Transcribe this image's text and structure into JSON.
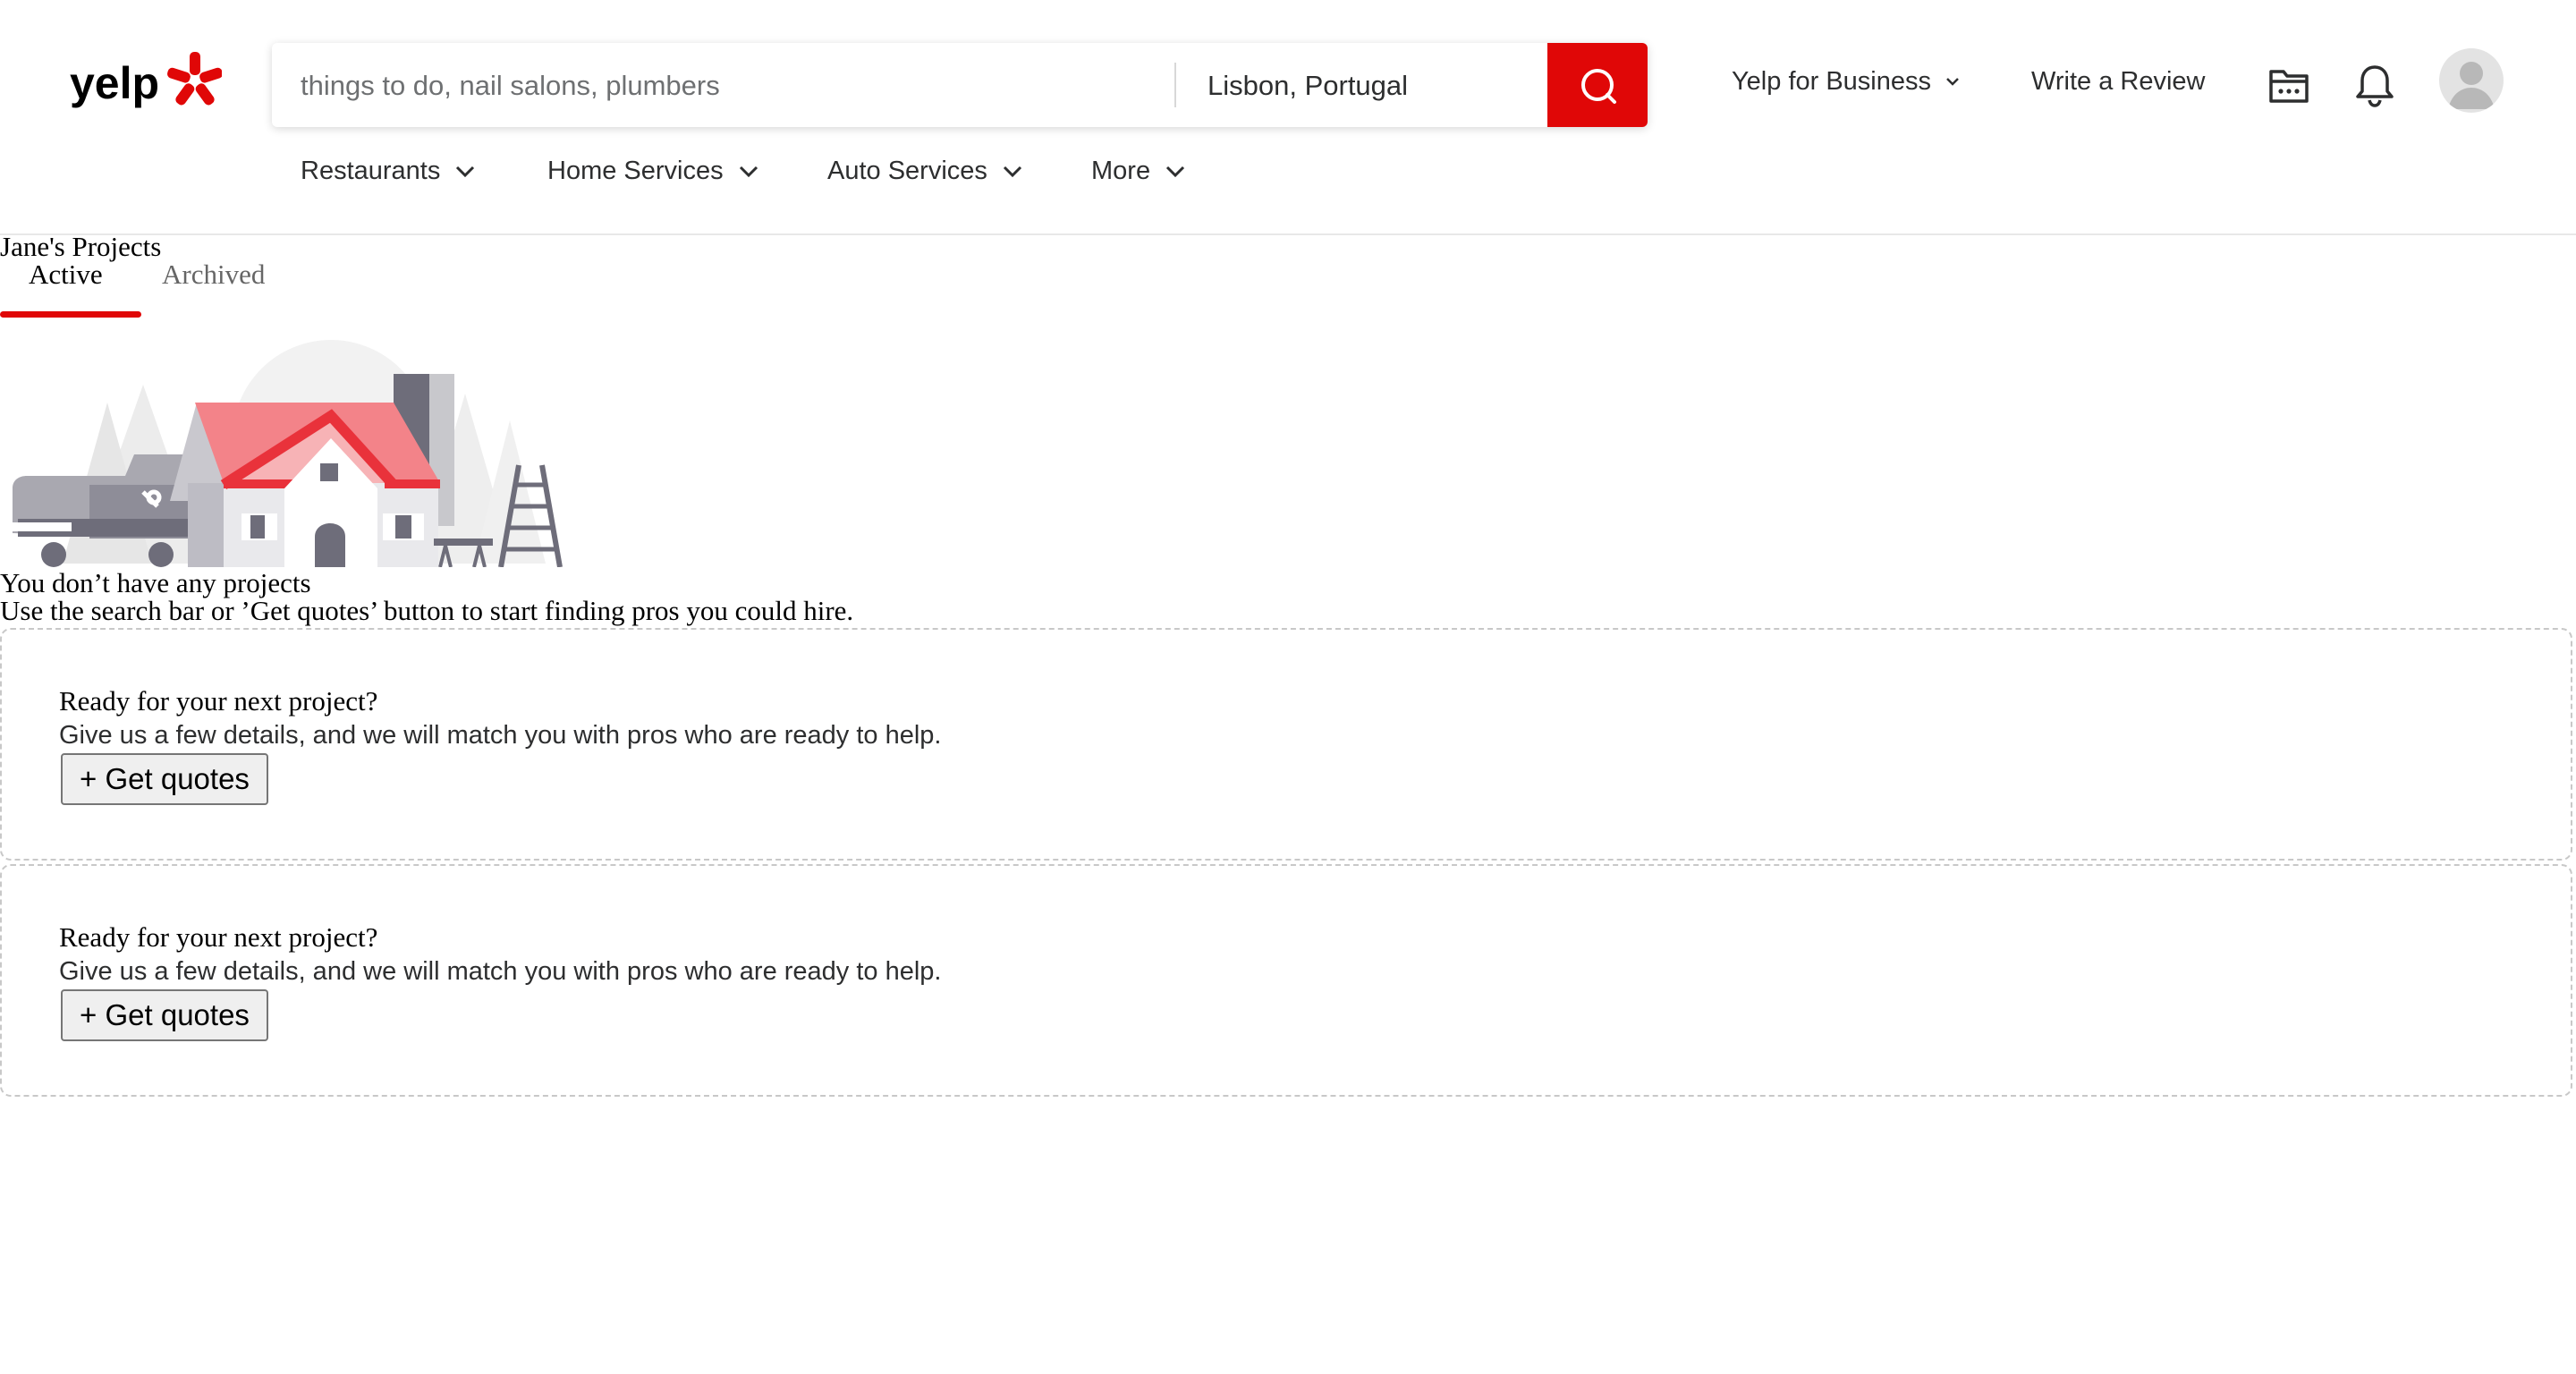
{
  "header": {
    "logo_text": "yelp",
    "search": {
      "find_placeholder": "things to do, nail salons, plumbers",
      "find_value": "",
      "near_value": "Lisbon, Portugal"
    },
    "yelp_for_business": "Yelp for Business",
    "write_review": "Write a Review",
    "icons": [
      "search-icon",
      "projects-icon",
      "bell-icon",
      "avatar-icon",
      "chevron-down-icon"
    ]
  },
  "categories": [
    {
      "label": "Restaurants"
    },
    {
      "label": "Home Services"
    },
    {
      "label": "Auto Services"
    },
    {
      "label": "More"
    }
  ],
  "projects": {
    "title": "Jane's Projects",
    "tabs": [
      {
        "label": "Active",
        "active": true
      },
      {
        "label": "Archived",
        "active": false
      }
    ],
    "empty_title": "You don’t have any projects",
    "empty_subtitle": "Use the search bar or ’Get quotes’ button to start finding pros you could hire."
  },
  "cards": [
    {
      "title": "Ready for your next project?",
      "subtitle": "Give us a few details, and we will match you with pros who are ready to help.",
      "button": "+ Get quotes"
    },
    {
      "title": "Ready for your next project?",
      "subtitle": "Give us a few details, and we will match you with pros who are ready to help.",
      "button": "+ Get quotes"
    }
  ],
  "colors": {
    "brand_red": "#e00707",
    "text": "#2d2e2f",
    "roof": "#f38389",
    "gray_dark": "#6e6d7a"
  }
}
